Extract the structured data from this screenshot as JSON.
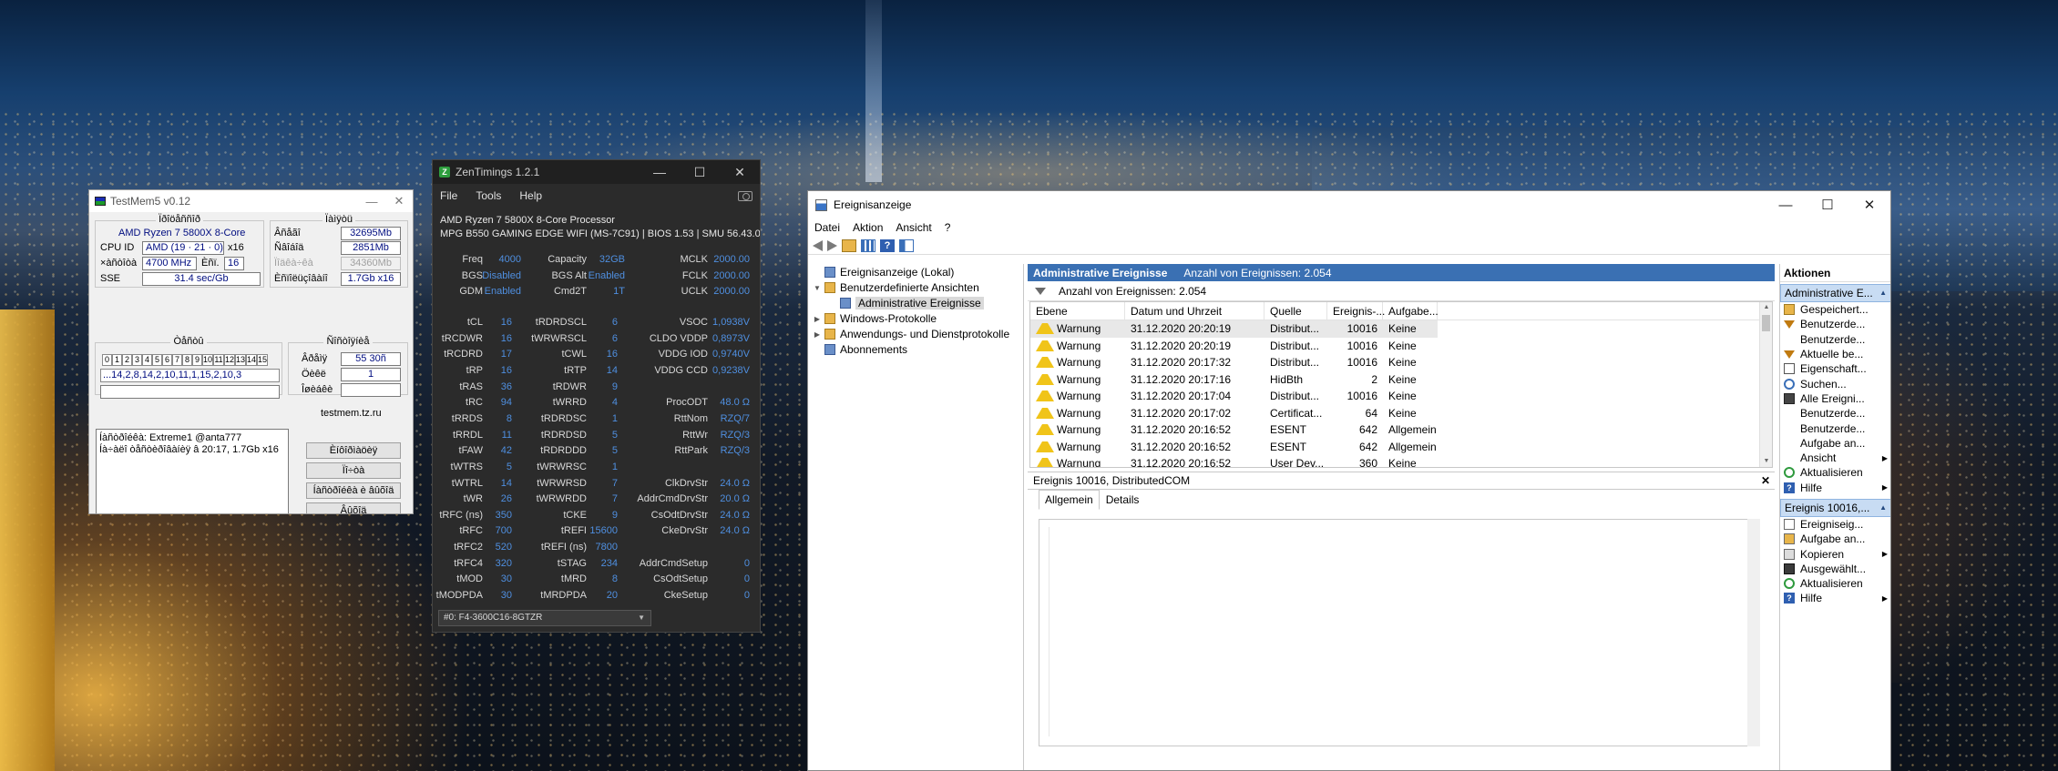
{
  "testmem5": {
    "title": "TestMem5 v0.12",
    "processor_group": "Ïðîöåññîð",
    "cpu_name": "AMD Ryzen 7 5800X 8-Core",
    "cpu_id_label": "CPU ID",
    "cpu_id_value": "AMD  (19 · 21 · 0)",
    "cpu_threads": "x16",
    "freq_label": "×àñòîòà",
    "freq_value": "4700 MHz",
    "used_label": "Èñï.",
    "used_value": "16",
    "sse_label": "SSE",
    "sse_value": "31.4 sec/Gb",
    "memory_group": "Ïàìÿòü",
    "mem_total_label": "Âñåãî",
    "mem_total_value": "32695Mb",
    "mem_free_label": "Ñâîáîä",
    "mem_free_value": "2851Mb",
    "mem_pagefile_label": "Ïîäêà÷êà",
    "mem_pagefile_value": "34360Mb",
    "mem_used_label": "Èñïîëüçîâàíî",
    "mem_used_value": "1.7Gb x16",
    "tests_group": "Òåñòû",
    "threads": [
      "0",
      "1",
      "2",
      "3",
      "4",
      "5",
      "6",
      "7",
      "8",
      "9",
      "10",
      "11",
      "12",
      "13",
      "14",
      "15"
    ],
    "errors_line": "...14,2,8,14,2,10,11,1,15,2,10,3",
    "status_group": "Ñîñòîÿíèå",
    "time_label": "Âðåìÿ",
    "time_value": "55 30ñ",
    "cycle_label": "Öèêë",
    "cycle_value": "1",
    "errors_label": "Îøèáêè",
    "errors_value": "",
    "site": "testmem.tz.ru",
    "log_line1": "Íàñòðîéêà: Extreme1 @anta777",
    "log_line2": "Íà÷àëî òåñòèðîâàíèÿ â 20:17, 1.7Gb x16",
    "btn1": "Èíôîðìàöèÿ",
    "btn2": "Ïî÷òà",
    "btn3": "Íàñòðîéêà è âûõîä",
    "btn4": "Âûõîä"
  },
  "zentimings": {
    "title": "ZenTimings 1.2.1",
    "menu": [
      "File",
      "Tools",
      "Help"
    ],
    "cpu": "AMD Ryzen 7 5800X 8-Core Processor",
    "board": "MPG B550 GAMING EDGE WIFI (MS-7C91) | BIOS 1.53 | SMU 56.43.00",
    "col1": [
      {
        "label": "Freq",
        "value": "4000"
      },
      {
        "label": "BGS",
        "value": "Disabled"
      },
      {
        "label": "GDM",
        "value": "Enabled"
      }
    ],
    "col2": [
      {
        "label": "Capacity",
        "value": "32GB"
      },
      {
        "label": "BGS Alt",
        "value": "Enabled"
      },
      {
        "label": "Cmd2T",
        "value": "1T"
      }
    ],
    "col3": [
      {
        "label": "MCLK",
        "value": "2000.00"
      },
      {
        "label": "FCLK",
        "value": "2000.00"
      },
      {
        "label": "UCLK",
        "value": "2000.00"
      }
    ],
    "timings_a": [
      {
        "label": "tCL",
        "value": "16"
      },
      {
        "label": "tRCDWR",
        "value": "16"
      },
      {
        "label": "tRCDRD",
        "value": "17"
      },
      {
        "label": "tRP",
        "value": "16"
      },
      {
        "label": "tRAS",
        "value": "36"
      },
      {
        "label": "tRC",
        "value": "94"
      },
      {
        "label": "tRRDS",
        "value": "8"
      },
      {
        "label": "tRRDL",
        "value": "11"
      },
      {
        "label": "tFAW",
        "value": "42"
      },
      {
        "label": "tWTRS",
        "value": "5"
      },
      {
        "label": "tWTRL",
        "value": "14"
      },
      {
        "label": "tWR",
        "value": "26"
      },
      {
        "label": "tRFC (ns)",
        "value": "350"
      },
      {
        "label": "tRFC",
        "value": "700"
      },
      {
        "label": "tRFC2",
        "value": "520"
      },
      {
        "label": "tRFC4",
        "value": "320"
      },
      {
        "label": "tMOD",
        "value": "30"
      },
      {
        "label": "tMODPDA",
        "value": "30"
      }
    ],
    "timings_b": [
      {
        "label": "tRDRDSCL",
        "value": "6"
      },
      {
        "label": "tWRWRSCL",
        "value": "6"
      },
      {
        "label": "tCWL",
        "value": "16"
      },
      {
        "label": "tRTP",
        "value": "14"
      },
      {
        "label": "tRDWR",
        "value": "9"
      },
      {
        "label": "tWRRD",
        "value": "4"
      },
      {
        "label": "tRDRDSC",
        "value": "1"
      },
      {
        "label": "tRDRDSD",
        "value": "5"
      },
      {
        "label": "tRDRDDD",
        "value": "5"
      },
      {
        "label": "tWRWRSC",
        "value": "1"
      },
      {
        "label": "tWRWRSD",
        "value": "7"
      },
      {
        "label": "tWRWRDD",
        "value": "7"
      },
      {
        "label": "tCKE",
        "value": "9"
      },
      {
        "label": "tREFI",
        "value": "15600"
      },
      {
        "label": "tREFI (ns)",
        "value": "7800"
      },
      {
        "label": "tSTAG",
        "value": "234"
      },
      {
        "label": "tMRD",
        "value": "8"
      },
      {
        "label": "tMRDPDA",
        "value": "20"
      }
    ],
    "volts": [
      {
        "label": "VSOC",
        "value": "1,0938V"
      },
      {
        "label": "CLDO VDDP",
        "value": "0,8973V"
      },
      {
        "label": "VDDG IOD",
        "value": "0,9740V"
      },
      {
        "label": "VDDG CCD",
        "value": "0,9238V"
      },
      {
        "label": "",
        "value": ""
      },
      {
        "label": "ProcODT",
        "value": "48.0 Ω"
      },
      {
        "label": "RttNom",
        "value": "RZQ/7"
      },
      {
        "label": "RttWr",
        "value": "RZQ/3"
      },
      {
        "label": "RttPark",
        "value": "RZQ/3"
      },
      {
        "label": "",
        "value": ""
      },
      {
        "label": "ClkDrvStr",
        "value": "24.0 Ω"
      },
      {
        "label": "AddrCmdDrvStr",
        "value": "20.0 Ω"
      },
      {
        "label": "CsOdtDrvStr",
        "value": "24.0 Ω"
      },
      {
        "label": "CkeDrvStr",
        "value": "24.0 Ω"
      },
      {
        "label": "",
        "value": ""
      },
      {
        "label": "AddrCmdSetup",
        "value": "0"
      },
      {
        "label": "CsOdtSetup",
        "value": "0"
      },
      {
        "label": "CkeSetup",
        "value": "0"
      }
    ],
    "dimm": "#0: F4-3600C16-8GTZR"
  },
  "eventviewer": {
    "title": "Ereignisanzeige",
    "menu": [
      "Datei",
      "Aktion",
      "Ansicht",
      "?"
    ],
    "tree": {
      "root": "Ereignisanzeige (Lokal)",
      "custom": "Benutzerdefinierte Ansichten",
      "admin": "Administrative Ereignisse",
      "winlogs": "Windows-Protokolle",
      "applogs": "Anwendungs- und Dienstprotokolle",
      "subs": "Abonnements"
    },
    "section_title": "Administrative Ereignisse",
    "section_count": "Anzahl von Ereignissen: 2.054",
    "filter_text": "Anzahl von Ereignissen: 2.054",
    "columns": [
      "Ebene",
      "Datum und Uhrzeit",
      "Quelle",
      "Ereignis-...",
      "Aufgabe..."
    ],
    "rows": [
      [
        "Warnung",
        "31.12.2020 20:20:19",
        "Distribut...",
        "10016",
        "Keine"
      ],
      [
        "Warnung",
        "31.12.2020 20:20:19",
        "Distribut...",
        "10016",
        "Keine"
      ],
      [
        "Warnung",
        "31.12.2020 20:17:32",
        "Distribut...",
        "10016",
        "Keine"
      ],
      [
        "Warnung",
        "31.12.2020 20:17:16",
        "HidBth",
        "2",
        "Keine"
      ],
      [
        "Warnung",
        "31.12.2020 20:17:04",
        "Distribut...",
        "10016",
        "Keine"
      ],
      [
        "Warnung",
        "31.12.2020 20:17:02",
        "Certificat...",
        "64",
        "Keine"
      ],
      [
        "Warnung",
        "31.12.2020 20:16:52",
        "ESENT",
        "642",
        "Allgemein"
      ],
      [
        "Warnung",
        "31.12.2020 20:16:52",
        "ESENT",
        "642",
        "Allgemein"
      ],
      [
        "Warnung",
        "31.12.2020 20:16:52",
        "User Dev...",
        "360",
        "Keine"
      ],
      [
        "Warnung",
        "31.12.2020 20:16:51",
        "Distribut...",
        "10016",
        "Keine"
      ]
    ],
    "detail_title": "Ereignis 10016, DistributedCOM",
    "tabs": [
      "Allgemein",
      "Details"
    ],
    "actions_title": "Aktionen",
    "actions_sec1": "Administrative E...",
    "actions1": [
      {
        "label": "Gespeichert...",
        "icon": "open-icon",
        "sub": ""
      },
      {
        "label": "Benutzerde...",
        "icon": "filter-icon",
        "sub": ""
      },
      {
        "label": "Benutzerde...",
        "icon": "blank-icon",
        "sub": ""
      },
      {
        "label": "Aktuelle be...",
        "icon": "filter-icon",
        "sub": ""
      },
      {
        "label": "Eigenschaft...",
        "icon": "props-icon",
        "sub": ""
      },
      {
        "label": "Suchen...",
        "icon": "search-icon",
        "sub": ""
      },
      {
        "label": "Alle Ereigni...",
        "icon": "clear-icon",
        "sub": ""
      },
      {
        "label": "Benutzerde...",
        "icon": "blank-icon",
        "sub": ""
      },
      {
        "label": "Benutzerde...",
        "icon": "blank-icon",
        "sub": ""
      },
      {
        "label": "Aufgabe an...",
        "icon": "blank-icon",
        "sub": ""
      },
      {
        "label": "Ansicht",
        "icon": "blank-icon",
        "sub": "▶"
      },
      {
        "label": "Aktualisieren",
        "icon": "refresh-icon",
        "sub": ""
      },
      {
        "label": "Hilfe",
        "icon": "help-icon",
        "sub": "▶"
      }
    ],
    "actions_sec2": "Ereignis 10016,...",
    "actions2": [
      {
        "label": "Ereigniseig...",
        "icon": "event-icon",
        "sub": ""
      },
      {
        "label": "Aufgabe an...",
        "icon": "task-icon",
        "sub": ""
      },
      {
        "label": "Kopieren",
        "icon": "copy-icon",
        "sub": "▶"
      },
      {
        "label": "Ausgewählt...",
        "icon": "save-icon",
        "sub": ""
      },
      {
        "label": "Aktualisieren",
        "icon": "refresh-icon",
        "sub": ""
      },
      {
        "label": "Hilfe",
        "icon": "help-icon",
        "sub": "▶"
      }
    ]
  }
}
